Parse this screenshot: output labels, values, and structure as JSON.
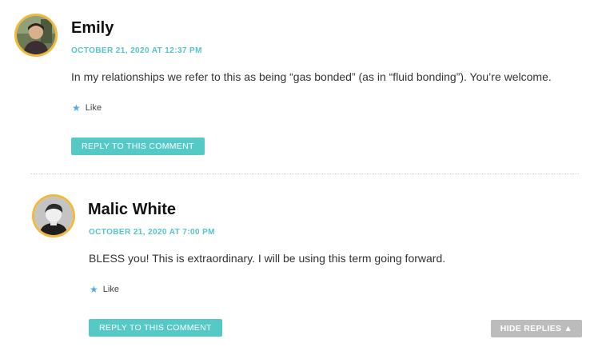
{
  "comments": [
    {
      "author": "Emily",
      "date": "OCTOBER 21, 2020 AT 12:37 PM",
      "text": "In my relationships we refer to this as being “gas bonded” (as in “fluid bonding”). You’re welcome.",
      "like_label": "Like",
      "reply_label": "REPLY TO THIS COMMENT"
    },
    {
      "author": "Malic White",
      "date": "OCTOBER 21, 2020 AT 7:00 PM",
      "text": "BLESS you! This is extraordinary. I will be using this term going forward.",
      "like_label": "Like",
      "reply_label": "REPLY TO THIS COMMENT"
    }
  ],
  "hide_replies_label": "HIDE REPLIES",
  "hide_replies_icon": "triangle-up-icon",
  "colors": {
    "accent": "#55c3c8",
    "avatar_border": "#f0b93a",
    "like_star": "#55a9e0",
    "hide_button": "#bcbcbc"
  }
}
